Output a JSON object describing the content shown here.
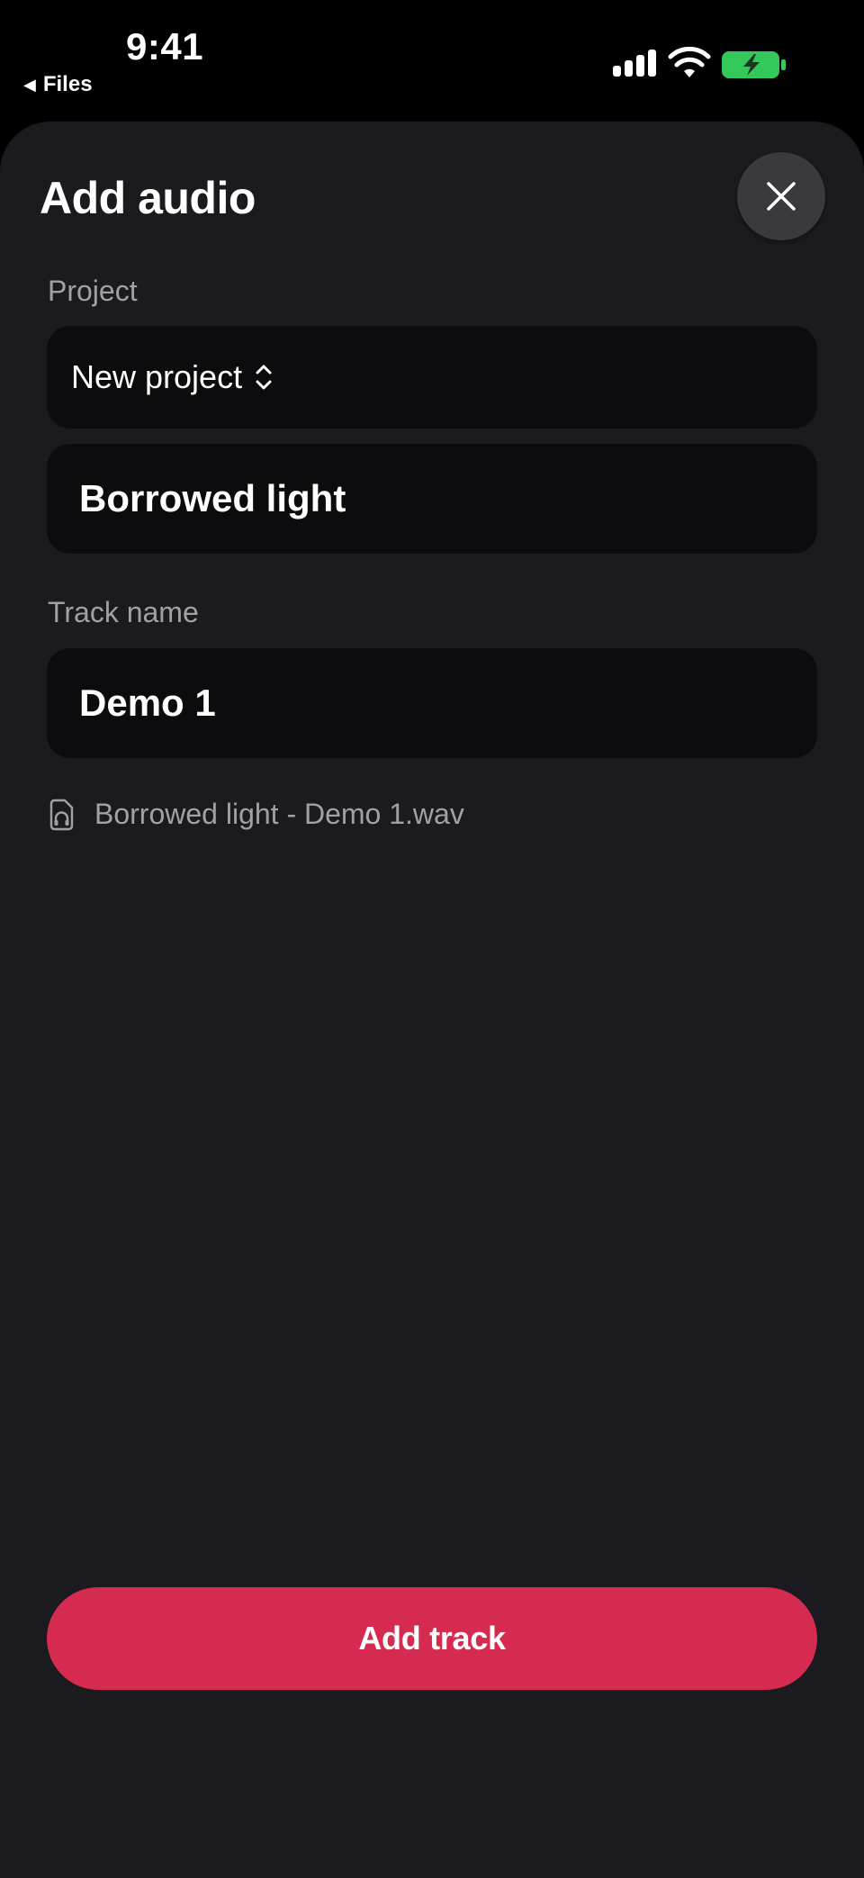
{
  "status_bar": {
    "time": "9:41",
    "back_label": "Files",
    "back_icon": "back-triangle-icon",
    "battery_color": "#34c759"
  },
  "sheet": {
    "title": "Add audio",
    "close_icon": "close-icon"
  },
  "project": {
    "label": "Project",
    "selected": "New project",
    "name_value": "Borrowed light"
  },
  "track": {
    "label": "Track name",
    "value": "Demo 1"
  },
  "file": {
    "icon": "audio-file-icon",
    "name": "Borrowed light - Demo 1.wav"
  },
  "actions": {
    "add_track_label": "Add track",
    "accent_color": "#d62b50"
  }
}
